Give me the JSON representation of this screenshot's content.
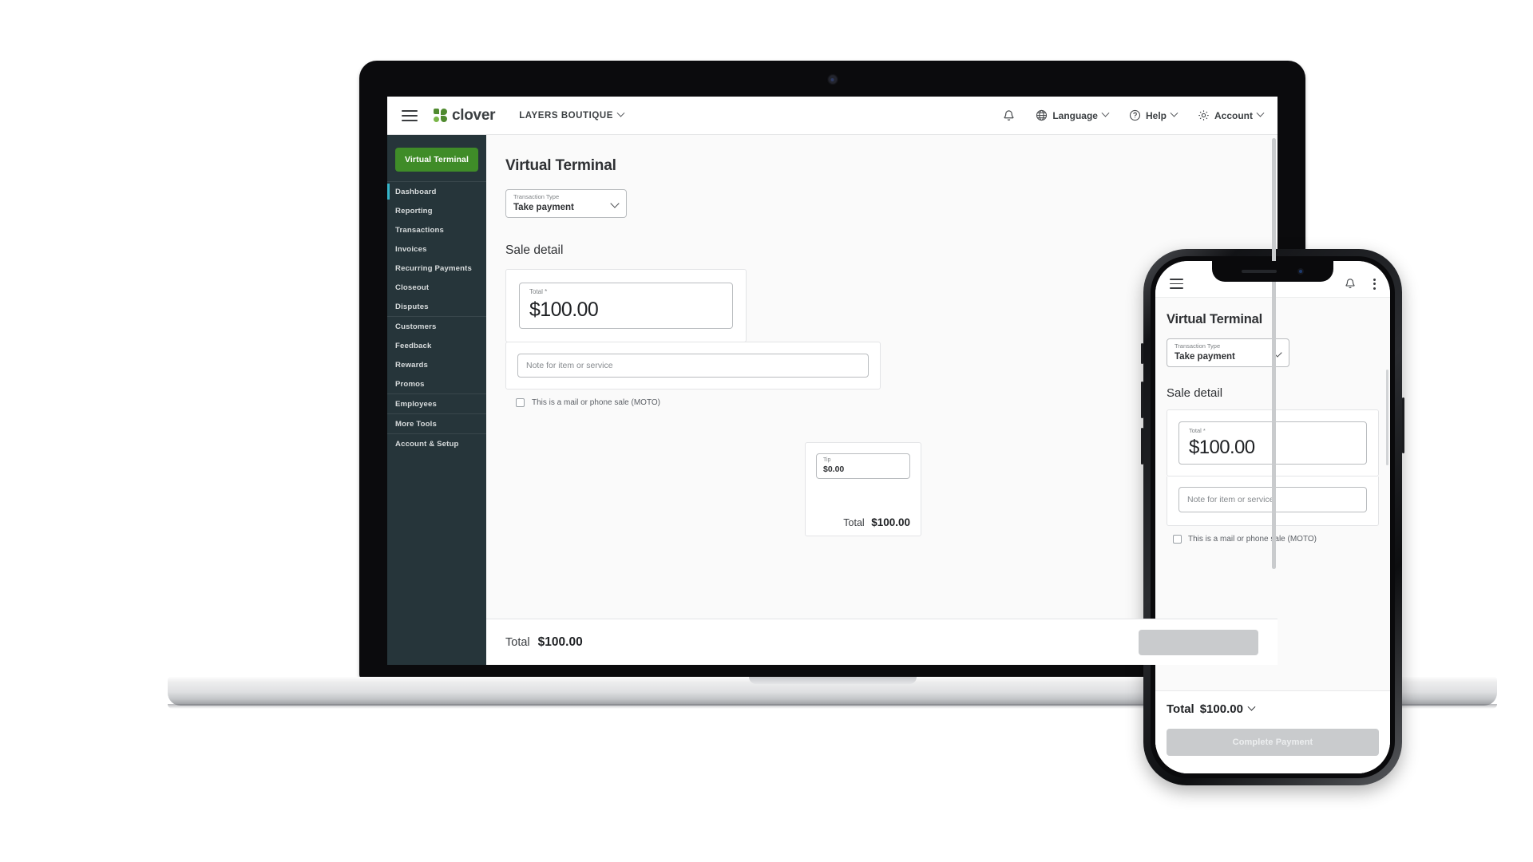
{
  "desktop": {
    "topbar": {
      "menu_icon": "hamburger-icon",
      "brand": "clover",
      "merchant": "LAYERS BOUTIQUE",
      "notifications_icon": "bell-icon",
      "language": "Language",
      "help": "Help",
      "account": "Account"
    },
    "sidebar": {
      "primary_button": "Virtual Terminal",
      "groups": [
        {
          "items": [
            {
              "label": "Dashboard",
              "active": true
            },
            {
              "label": "Reporting",
              "active": false
            },
            {
              "label": "Transactions",
              "active": false
            },
            {
              "label": "Invoices",
              "active": false
            },
            {
              "label": "Recurring Payments",
              "active": false
            },
            {
              "label": "Closeout",
              "active": false
            },
            {
              "label": "Disputes",
              "active": false
            }
          ]
        },
        {
          "items": [
            {
              "label": "Customers",
              "active": false
            },
            {
              "label": "Feedback",
              "active": false
            },
            {
              "label": "Rewards",
              "active": false
            },
            {
              "label": "Promos",
              "active": false
            }
          ]
        },
        {
          "items": [
            {
              "label": "Employees",
              "active": false
            }
          ]
        },
        {
          "items": [
            {
              "label": "More Tools",
              "active": false
            }
          ]
        },
        {
          "items": [
            {
              "label": "Account & Setup",
              "active": false
            }
          ]
        }
      ]
    },
    "main": {
      "page_title": "Virtual Terminal",
      "transaction_type_label": "Transaction Type",
      "transaction_type_value": "Take payment",
      "section_title": "Sale detail",
      "total_label": "Total *",
      "total_value": "$100.00",
      "note_placeholder": "Note for item or service",
      "moto_label": "This is a mail or phone sale (MOTO)",
      "tip_label": "Tip",
      "tip_value": "$0.00",
      "card_total_label": "Total",
      "card_total_value": "$100.00"
    },
    "bottom_bar": {
      "total_label": "Total",
      "total_value": "$100.00"
    }
  },
  "phone": {
    "topbar": {
      "menu_icon": "hamburger-icon",
      "notifications_icon": "bell-icon",
      "overflow_icon": "kebab-menu-icon"
    },
    "main": {
      "page_title": "Virtual Terminal",
      "transaction_type_label": "Transaction Type",
      "transaction_type_value": "Take payment",
      "section_title": "Sale detail",
      "total_label": "Total *",
      "total_value": "$100.00",
      "note_placeholder": "Note for item or service",
      "moto_label": "This is a mail or phone sale (MOTO)"
    },
    "footer": {
      "total_label": "Total",
      "total_value": "$100.00",
      "complete_button": "Complete Payment"
    }
  },
  "colors": {
    "brand_green": "#3f8c28",
    "sidebar_bg": "#26353a",
    "active_indicator": "#35b5c9",
    "disabled_button": "#c9cbcd"
  }
}
